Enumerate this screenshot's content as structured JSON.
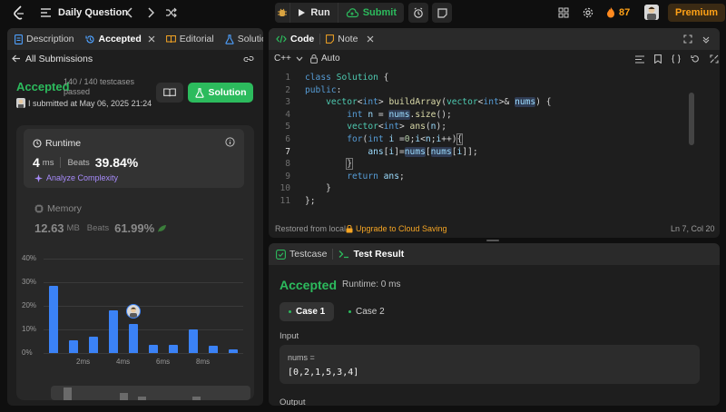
{
  "topbar": {
    "title": "Daily Question",
    "run_label": "Run",
    "submit_label": "Submit",
    "streak_count": "87",
    "premium_label": "Premium"
  },
  "left_tabs": [
    {
      "label": "Description"
    },
    {
      "label": "Accepted"
    },
    {
      "label": "Editorial"
    },
    {
      "label": "Solution"
    }
  ],
  "submissions": {
    "back_label": "All Submissions",
    "status": "Accepted",
    "testcases": "140 / 140 testcases",
    "passed": "passed",
    "submitted_text": "I submitted at May 06, 2025 21:24",
    "solution_label": "Solution"
  },
  "runtime": {
    "label": "Runtime",
    "value": "4",
    "unit": "ms",
    "beats_label": "Beats",
    "beats_value": "39.84%",
    "analyze_label": "Analyze Complexity"
  },
  "memory": {
    "label": "Memory",
    "value": "12.63",
    "unit": "MB",
    "beats_label": "Beats",
    "beats_value": "61.99%"
  },
  "chart_data": {
    "type": "bar",
    "y_ticks": [
      "40%",
      "30%",
      "20%",
      "10%",
      "0%"
    ],
    "x_ticks": [
      "2ms",
      "4ms",
      "6ms",
      "8ms"
    ],
    "ylim": [
      0,
      40
    ],
    "values": [
      28.5,
      5.5,
      7,
      18,
      12.5,
      3.5,
      3.5,
      10,
      3,
      1.5
    ],
    "highlight_index": 4
  },
  "editor": {
    "code_tab": "Code",
    "note_tab": "Note",
    "language": "C++",
    "mode": "Auto",
    "restored": "Restored from local",
    "upgrade": "Upgrade to Cloud Saving",
    "cursor": "Ln 7, Col 20",
    "line_numbers": [
      "1",
      "2",
      "3",
      "4",
      "5",
      "6",
      "7",
      "8",
      "9",
      "10",
      "11"
    ]
  },
  "testpanel": {
    "testcase_tab": "Testcase",
    "result_tab": "Test Result",
    "status": "Accepted",
    "runtime": "Runtime: 0 ms",
    "case1": "Case 1",
    "case2": "Case 2",
    "input_label": "Input",
    "var_label": "nums =",
    "var_value": "[0,2,1,5,3,4]",
    "output_label": "Output"
  }
}
